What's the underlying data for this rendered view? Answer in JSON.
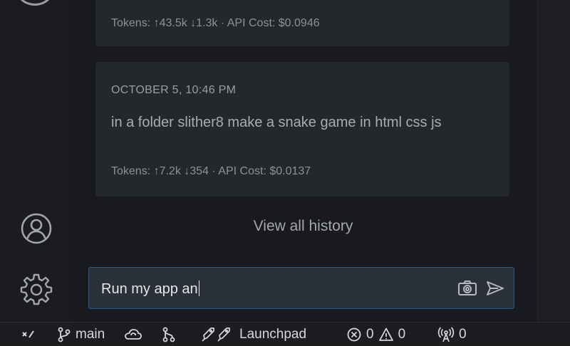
{
  "history": {
    "cards": [
      {
        "date": "",
        "task": "",
        "tokens": "Tokens: ↑43.5k ↓1.3k · API Cost: $0.0946"
      },
      {
        "date": "OCTOBER 5, 10:46 PM",
        "task": "in a folder slither8 make a snake game in html css js",
        "tokens": "Tokens: ↑7.2k ↓354 · API Cost: $0.0137"
      }
    ],
    "view_all_label": "View all history"
  },
  "activity_bar": {
    "icons": [
      "account-icon",
      "settings-gear-icon"
    ]
  },
  "chat": {
    "input_value": "Run my app an",
    "icons": [
      "camera-icon",
      "send-icon"
    ]
  },
  "status_bar": {
    "branch": "main",
    "launchpad": "Launchpad",
    "errors": "0",
    "warnings": "0",
    "ports": "0",
    "icons": [
      "remote-icon",
      "git-branch-icon",
      "sync-cloud-icon",
      "merge-icon",
      "rocket-icon",
      "error-icon",
      "warning-icon",
      "broadcast-icon"
    ]
  }
}
